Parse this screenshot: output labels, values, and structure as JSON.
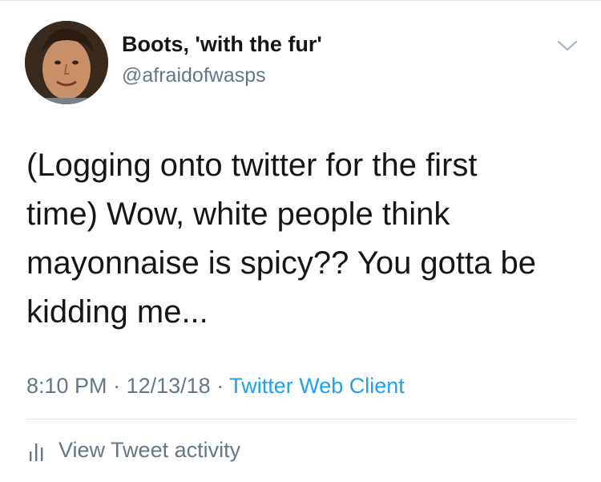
{
  "author": {
    "display_name": "Boots, 'with the fur'",
    "handle": "@afraidofwasps",
    "avatar_icon": "profile-photo"
  },
  "tweet": {
    "text_lines": [
      "(Logging onto twitter for the first",
      "time) Wow, white people think",
      "mayonnaise is spicy?? You gotta be",
      "kidding me..."
    ]
  },
  "meta": {
    "time": "8:10 PM",
    "separator_1": "·",
    "date": "12/13/18",
    "separator_2": "·",
    "source": "Twitter Web Client"
  },
  "activity": {
    "label": "View Tweet activity",
    "icon": "bar-chart-icon"
  },
  "menu": {
    "icon": "chevron-down-icon"
  },
  "colors": {
    "text": "#14171a",
    "secondary": "#657786",
    "link": "#1da1f2",
    "divider": "#e1e8ed"
  }
}
